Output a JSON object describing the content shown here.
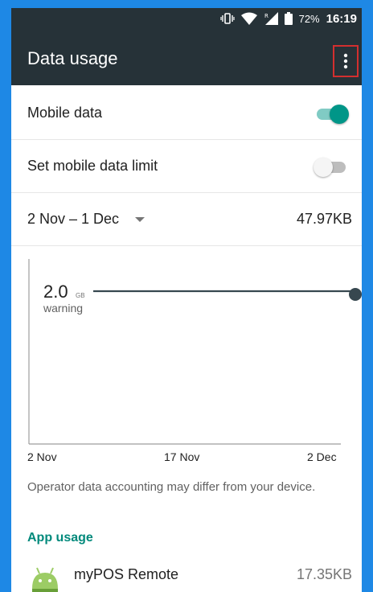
{
  "status_bar": {
    "battery": "72%",
    "time": "16:19"
  },
  "app_bar": {
    "title": "Data usage"
  },
  "settings": {
    "mobile_data": {
      "label": "Mobile data",
      "enabled": true
    },
    "data_limit": {
      "label": "Set mobile data limit",
      "enabled": false
    },
    "cycle": {
      "range": "2 Nov – 1 Dec",
      "total": "47.97KB"
    }
  },
  "chart_data": {
    "type": "line",
    "x_ticks": [
      "2 Nov",
      "17 Nov",
      "2 Dec"
    ],
    "warning_value": "2.0",
    "warning_unit": "GB",
    "warning_label": "warning"
  },
  "note": "Operator data accounting may differ from your device.",
  "app_usage": {
    "header": "App usage",
    "apps": [
      {
        "name": "myPOS Remote",
        "size": "17.35KB"
      }
    ]
  },
  "colors": {
    "accent": "#009688",
    "appbar": "#263238",
    "frame": "#1e88e5"
  }
}
